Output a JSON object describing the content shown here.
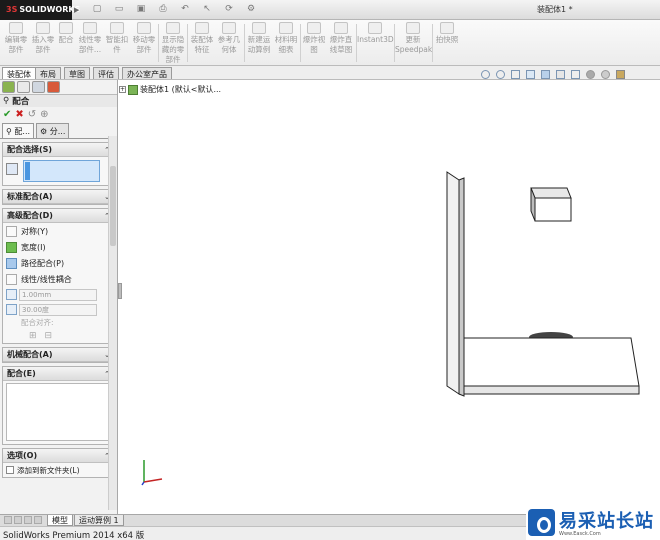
{
  "app": {
    "logo_prefix": "3S",
    "logo_text": "SOLIDWORKS",
    "document_title": "装配体1 *"
  },
  "ribbon": {
    "buttons": [
      {
        "label1": "编辑零",
        "label2": "部件"
      },
      {
        "label1": "插入零",
        "label2": "部件"
      },
      {
        "label1": "配合",
        "label2": ""
      },
      {
        "label1": "线性零",
        "label2": "部件..."
      },
      {
        "label1": "智能扣",
        "label2": "件"
      },
      {
        "label1": "移动零",
        "label2": "部件"
      },
      {
        "label1": "显示隐",
        "label2": "藏的零",
        "label3": "部件"
      },
      {
        "label1": "装配体",
        "label2": "特征"
      },
      {
        "label1": "参考几",
        "label2": "何体"
      },
      {
        "label1": "新建运",
        "label2": "动算例"
      },
      {
        "label1": "材料明",
        "label2": "细表"
      },
      {
        "label1": "爆炸视",
        "label2": "图"
      },
      {
        "label1": "爆炸直",
        "label2": "线草图"
      },
      {
        "label1": "Instant3D",
        "label2": ""
      },
      {
        "label1": "更新",
        "label2": "Speedpak"
      },
      {
        "label1": "拍快照",
        "label2": ""
      }
    ]
  },
  "tabs": [
    "装配体",
    "布局",
    "草图",
    "评估",
    "办公室产品"
  ],
  "tree": {
    "root_label": "装配体1 (默认<默认..."
  },
  "property_manager": {
    "title": "配合",
    "subtabs": [
      "配...",
      "分..."
    ],
    "groups": {
      "selections": "配合选择(S)",
      "standard": "标准配合(A)",
      "advanced": "高级配合(D)",
      "mechanical": "机械配合(A)",
      "mates": "配合(E)",
      "options": "选项(O)"
    },
    "advanced_options": [
      "对称(Y)",
      "宽度(I)",
      "路径配合(P)",
      "线性/线性耦合"
    ],
    "distance_value": "1.00mm",
    "angle_value": "30.00度",
    "alignment_label": "配合对齐:",
    "add_to_folder_label": "添加到新文件夹(L)"
  },
  "bottom_tabs": [
    "模型",
    "运动算例 1"
  ],
  "status": {
    "text": "SolidWorks Premium 2014 x64 版"
  },
  "watermark": {
    "title": "易采站长站",
    "subtitle": "Www.Easck.Com"
  }
}
